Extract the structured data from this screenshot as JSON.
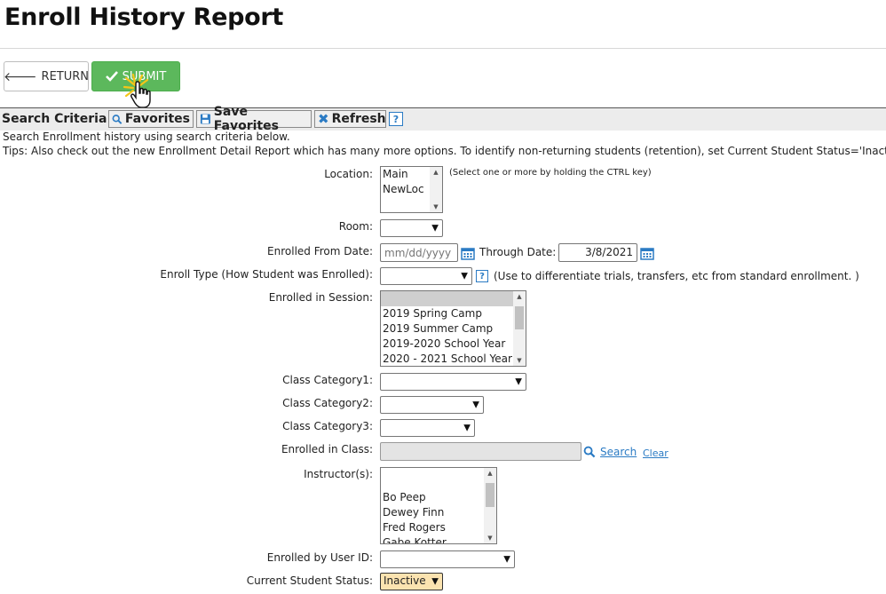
{
  "header": {
    "title": "Enroll History Report"
  },
  "toolbar": {
    "return_label": "RETURN",
    "submit_label": "SUBMIT"
  },
  "criteria": {
    "title": "Search Criteria",
    "favorites_label": "Favorites",
    "save_favorites_label": "Save Favorites",
    "refresh_label": "Refresh",
    "help_label": "?"
  },
  "info": {
    "line1": "Search Enrollment history using search criteria below.",
    "line2": "Tips: Also check out the new Enrollment Detail Report which has many more options. To identify non-returning students (retention), set Current Student Status='Inactive'."
  },
  "form": {
    "location": {
      "label": "Location:",
      "options": [
        "Main",
        "NewLoc"
      ],
      "hint": "(Select one or more by holding the CTRL key)"
    },
    "room": {
      "label": "Room:",
      "value": ""
    },
    "enrolled_from": {
      "label": "Enrolled From Date:",
      "placeholder": "mm/dd/yyyy",
      "value": ""
    },
    "through_date": {
      "label": "Through Date:",
      "value": "3/8/2021"
    },
    "enroll_type": {
      "label": "Enroll Type (How Student was Enrolled):",
      "value": "",
      "help": "?",
      "hint": "(Use to differentiate trials, transfers, etc from standard enrollment. )"
    },
    "session": {
      "label": "Enrolled in Session:",
      "options": [
        "",
        "2019 Spring Camp",
        "2019 Summer Camp",
        "2019-2020 School Year",
        "2020 - 2021 School Year"
      ]
    },
    "class_category1": {
      "label": "Class Category1:",
      "value": ""
    },
    "class_category2": {
      "label": "Class Category2:",
      "value": ""
    },
    "class_category3": {
      "label": "Class Category3:",
      "value": ""
    },
    "enrolled_class": {
      "label": "Enrolled in Class:",
      "value": "",
      "search_label": "Search",
      "clear_label": "Clear"
    },
    "instructors": {
      "label": "Instructor(s):",
      "options": [
        "",
        "",
        "Bo Peep",
        "Dewey Finn",
        "Fred Rogers",
        "Gabe Kotter"
      ]
    },
    "enrolled_by": {
      "label": "Enrolled by User ID:",
      "value": ""
    },
    "student_status": {
      "label": "Current Student Status:",
      "value": "Inactive"
    }
  },
  "colors": {
    "submit": "#5cb85c",
    "accent": "#2b7bc4",
    "status_bg": "#fbe3b0"
  }
}
